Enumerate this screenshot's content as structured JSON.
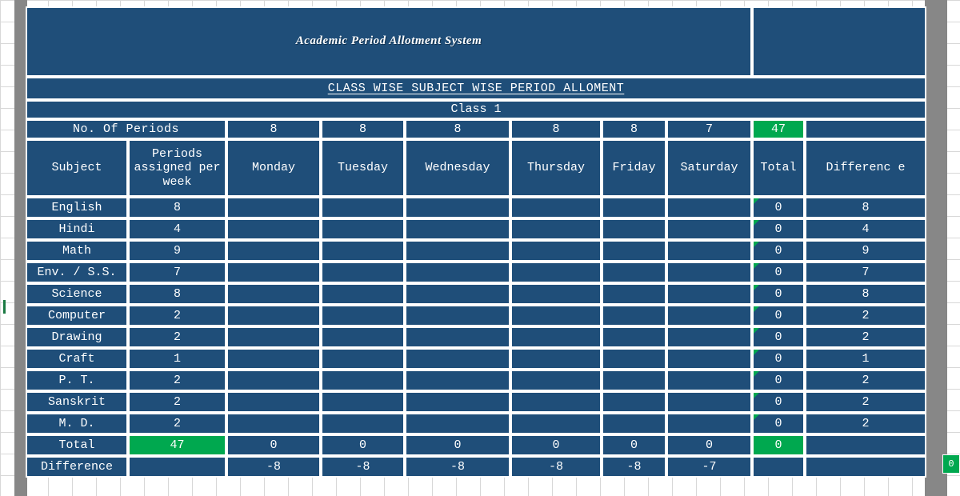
{
  "app": {
    "title": "Academic Period Allotment System",
    "subtitle": "CLASS WISE SUBJECT WISE PERIOD ALLOMENT",
    "class_label": "Class 1",
    "title_blank": "",
    "colors": {
      "dark_blue": "#1f4e79",
      "light_blue": "#5089d0",
      "green": "#00a84f",
      "grid_gray": "#878787",
      "text": "#ffffff"
    }
  },
  "periods_row": {
    "label": "No. Of Periods",
    "days": [
      8,
      8,
      8,
      8,
      8,
      7
    ],
    "total": 47,
    "difference": ""
  },
  "headers": {
    "subject": "Subject",
    "assigned": "Periods assigned per week",
    "days": [
      "Monday",
      "Tuesday",
      "Wednesday",
      "Thursday",
      "Friday",
      "Saturday"
    ],
    "total": "Total",
    "difference": "Differenc e"
  },
  "rows": [
    {
      "subject": "English",
      "assigned": 8,
      "mon": "",
      "tue": "",
      "wed": "",
      "thu": "",
      "fri": "",
      "sat": "",
      "total": 0,
      "difference": 8
    },
    {
      "subject": "Hindi",
      "assigned": 4,
      "mon": "",
      "tue": "",
      "wed": "",
      "thu": "",
      "fri": "",
      "sat": "",
      "total": 0,
      "difference": 4
    },
    {
      "subject": "Math",
      "assigned": 9,
      "mon": "",
      "tue": "",
      "wed": "",
      "thu": "",
      "fri": "",
      "sat": "",
      "total": 0,
      "difference": 9
    },
    {
      "subject": "Env. / S.S.",
      "assigned": 7,
      "mon": "",
      "tue": "",
      "wed": "",
      "thu": "",
      "fri": "",
      "sat": "",
      "total": 0,
      "difference": 7
    },
    {
      "subject": "Science",
      "assigned": 8,
      "mon": "",
      "tue": "",
      "wed": "",
      "thu": "",
      "fri": "",
      "sat": "",
      "total": 0,
      "difference": 8
    },
    {
      "subject": "Computer",
      "assigned": 2,
      "mon": "",
      "tue": "",
      "wed": "",
      "thu": "",
      "fri": "",
      "sat": "",
      "total": 0,
      "difference": 2
    },
    {
      "subject": "Drawing",
      "assigned": 2,
      "mon": "",
      "tue": "",
      "wed": "",
      "thu": "",
      "fri": "",
      "sat": "",
      "total": 0,
      "difference": 2
    },
    {
      "subject": "Craft",
      "assigned": 1,
      "mon": "",
      "tue": "",
      "wed": "",
      "thu": "",
      "fri": "",
      "sat": "",
      "total": 0,
      "difference": 1
    },
    {
      "subject": "P. T.",
      "assigned": 2,
      "mon": "",
      "tue": "",
      "wed": "",
      "thu": "",
      "fri": "",
      "sat": "",
      "total": 0,
      "difference": 2
    },
    {
      "subject": "Sanskrit",
      "assigned": 2,
      "mon": "",
      "tue": "",
      "wed": "",
      "thu": "",
      "fri": "",
      "sat": "",
      "total": 0,
      "difference": 2
    },
    {
      "subject": "M. D.",
      "assigned": 2,
      "mon": "",
      "tue": "",
      "wed": "",
      "thu": "",
      "fri": "",
      "sat": "",
      "total": 0,
      "difference": 2
    }
  ],
  "total_row": {
    "label": "Total",
    "assigned": 47,
    "days": [
      0,
      0,
      0,
      0,
      0,
      0
    ],
    "total": 0,
    "difference": ""
  },
  "difference_row": {
    "label": "Difference",
    "assigned": "",
    "days": [
      -8,
      -8,
      -8,
      -8,
      -8,
      -7
    ],
    "total": "",
    "difference": ""
  },
  "stray_cell": {
    "value": 0
  }
}
